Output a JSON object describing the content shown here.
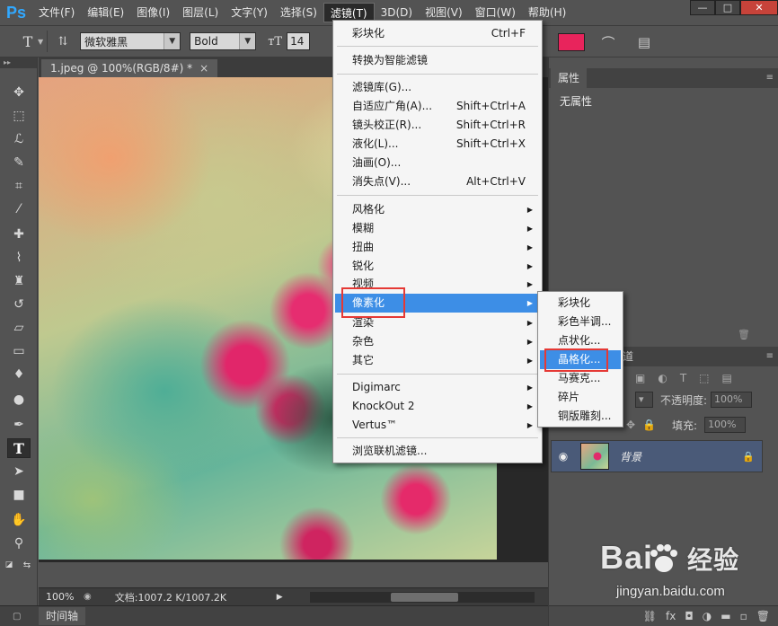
{
  "app": {
    "logo": "Ps"
  },
  "menubar": {
    "items": [
      "文件(F)",
      "编辑(E)",
      "图像(I)",
      "图层(L)",
      "文字(Y)",
      "选择(S)",
      "滤镜(T)",
      "3D(D)",
      "视图(V)",
      "窗口(W)",
      "帮助(H)"
    ],
    "active_index": 6
  },
  "window_controls": {
    "minimize": "—",
    "maximize": "□",
    "close": "✕"
  },
  "options_bar": {
    "font_family": "微软雅黑",
    "font_style": "Bold",
    "font_size": "14",
    "text_color": "#e8245c"
  },
  "document": {
    "tab_title": "1.jpeg @ 100%(RGB/8#) *",
    "tab_close": "×",
    "zoom": "100%",
    "doc_size": "文档:1007.2 K/1007.2K"
  },
  "timeline": {
    "label": "时间轴"
  },
  "properties": {
    "tab": "属性",
    "value": "无属性"
  },
  "layers": {
    "tab_fragment": "道",
    "opacity_label": "不透明度:",
    "opacity_value": "100%",
    "fill_label": "填充:",
    "fill_value": "100%",
    "layer_name": "背景"
  },
  "filter_menu": {
    "items": [
      {
        "label": "彩块化",
        "shortcut": "Ctrl+F"
      },
      {
        "label": "转换为智能滤镜"
      },
      {
        "label": "滤镜库(G)..."
      },
      {
        "label": "自适应广角(A)...",
        "shortcut": "Shift+Ctrl+A"
      },
      {
        "label": "镜头校正(R)...",
        "shortcut": "Shift+Ctrl+R"
      },
      {
        "label": "液化(L)...",
        "shortcut": "Shift+Ctrl+X"
      },
      {
        "label": "油画(O)..."
      },
      {
        "label": "消失点(V)...",
        "shortcut": "Alt+Ctrl+V"
      },
      {
        "label": "风格化"
      },
      {
        "label": "模糊"
      },
      {
        "label": "扭曲"
      },
      {
        "label": "锐化"
      },
      {
        "label": "视频"
      },
      {
        "label": "像素化"
      },
      {
        "label": "渲染"
      },
      {
        "label": "杂色"
      },
      {
        "label": "其它"
      },
      {
        "label": "Digimarc"
      },
      {
        "label": "KnockOut 2"
      },
      {
        "label": "Vertus™"
      },
      {
        "label": "浏览联机滤镜..."
      }
    ],
    "highlighted": "像素化"
  },
  "pixelate_menu": {
    "items": [
      "彩块化",
      "彩色半调...",
      "点状化...",
      "晶格化...",
      "马赛克...",
      "碎片",
      "铜版雕刻..."
    ],
    "highlighted": "晶格化..."
  },
  "watermark": {
    "logo_left": "Bai",
    "logo_right": "经验",
    "url": "jingyan.baidu.com"
  }
}
